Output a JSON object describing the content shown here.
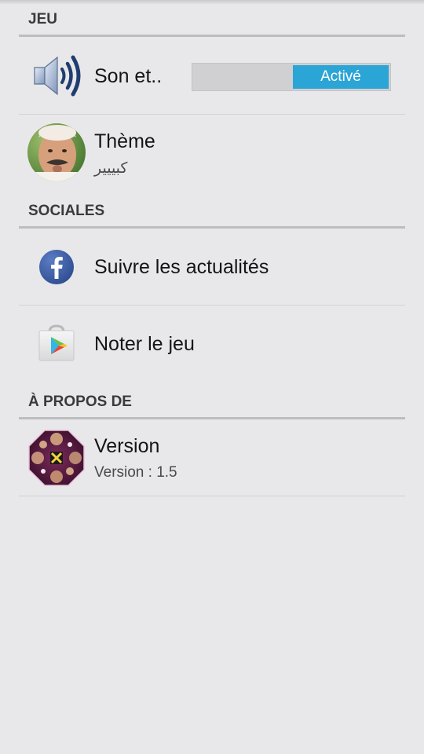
{
  "sections": {
    "game": {
      "header": "JEU",
      "sound": {
        "title": "Son et..",
        "toggle_label": "Activé",
        "icon": "speaker-icon",
        "enabled": true
      },
      "theme": {
        "title": "Thème",
        "subtitle": "كبييير",
        "icon": "theme-avatar"
      }
    },
    "social": {
      "header": "SOCIALES",
      "follow": {
        "title": "Suivre les actualités",
        "icon": "facebook-icon"
      },
      "rate": {
        "title": "Noter le jeu",
        "icon": "play-store-icon"
      }
    },
    "about": {
      "header": "À PROPOS DE",
      "version": {
        "title": "Version",
        "subtitle": "Version : 1.5",
        "icon": "app-logo-icon"
      }
    }
  },
  "colors": {
    "background": "#e8e8ea",
    "toggle_active": "#2aa5d6",
    "facebook": "#3b5998",
    "section_line": "#bdbdbf"
  }
}
